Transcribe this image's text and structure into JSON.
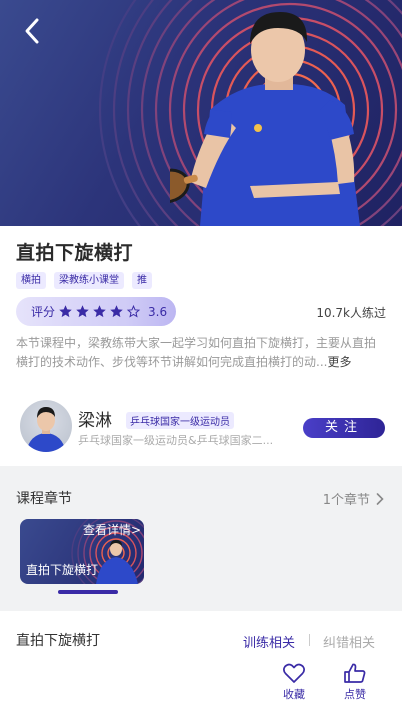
{
  "course": {
    "title": "直拍下旋横打",
    "tags": [
      "横拍",
      "梁教练小课堂",
      "推"
    ],
    "rating_label": "评分",
    "rating_value": "3.6",
    "rating_stars": 3.6,
    "practice_count": "10.7k人练过",
    "description": "本节课程中，梁教练带大家一起学习如何直拍下旋横打，主要从直拍横打的技术动作、步伐等环节讲解如何完成直拍横打的动...",
    "more_label": "更多"
  },
  "coach": {
    "name": "梁淋",
    "badge": "乒乓球国家一级运动员",
    "subtitle": "乒乓球国家一级运动员&乒乓球国家二...",
    "follow_label": "关注"
  },
  "chapters": {
    "title": "课程章节",
    "count": "1个章节",
    "items": [
      {
        "detail_label": "查看详情>",
        "name": "直拍下旋横打"
      }
    ]
  },
  "bottom": {
    "title": "直拍下旋横打",
    "tab_training": "训练相关",
    "tab_errors": "纠错相关",
    "favorite_label": "收藏",
    "like_label": "点赞"
  },
  "colors": {
    "accent": "#3a2ba6",
    "hero_bg": "#2c347a",
    "ring": "#e0564a"
  },
  "icons": {
    "back": "chevron-left-icon",
    "star": "star-icon",
    "chevron": "chevron-right-icon",
    "favorite": "heart-icon",
    "like": "thumbs-up-icon"
  }
}
